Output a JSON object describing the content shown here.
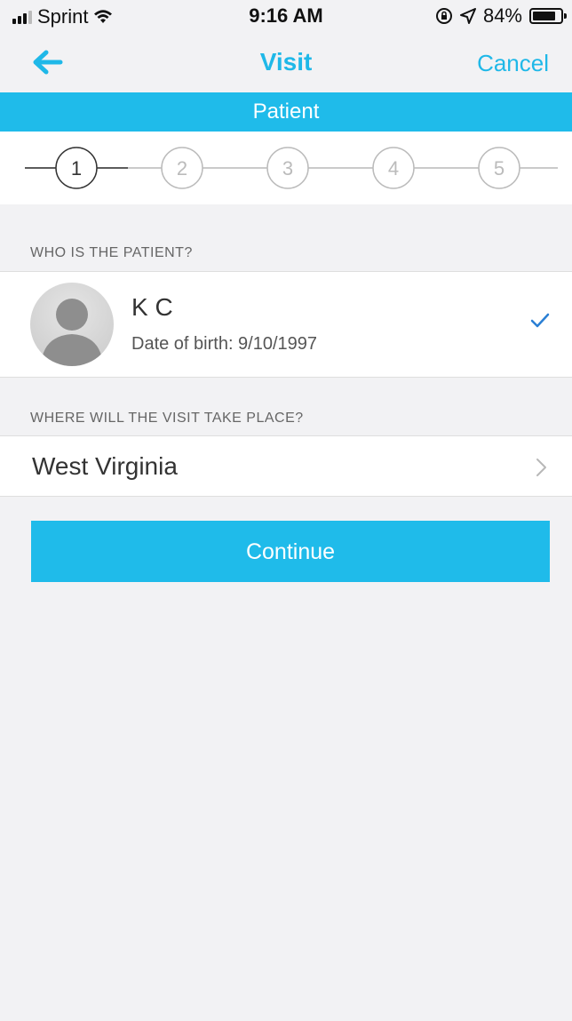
{
  "status_bar": {
    "carrier": "Sprint",
    "time": "9:16 AM",
    "battery_percent": "84%",
    "battery_level": 0.84,
    "icons": [
      "signal-icon",
      "wifi-icon",
      "rotation-lock-icon",
      "location-icon",
      "battery-icon"
    ]
  },
  "nav": {
    "title": "Visit",
    "cancel_label": "Cancel",
    "back_icon": "back-arrow-icon"
  },
  "section_title": "Patient",
  "stepper": {
    "steps": [
      "1",
      "2",
      "3",
      "4",
      "5"
    ],
    "active": 1
  },
  "patient_section": {
    "label": "WHO IS THE PATIENT?",
    "patient": {
      "name": "K C",
      "dob": "Date of birth: 9/10/1997",
      "selected": true
    }
  },
  "location_section": {
    "label": "WHERE WILL THE VISIT TAKE PLACE?",
    "value": "West Virginia"
  },
  "continue_label": "Continue",
  "colors": {
    "accent": "#1fbbea",
    "background": "#f2f2f4",
    "check": "#2a7fd4"
  }
}
